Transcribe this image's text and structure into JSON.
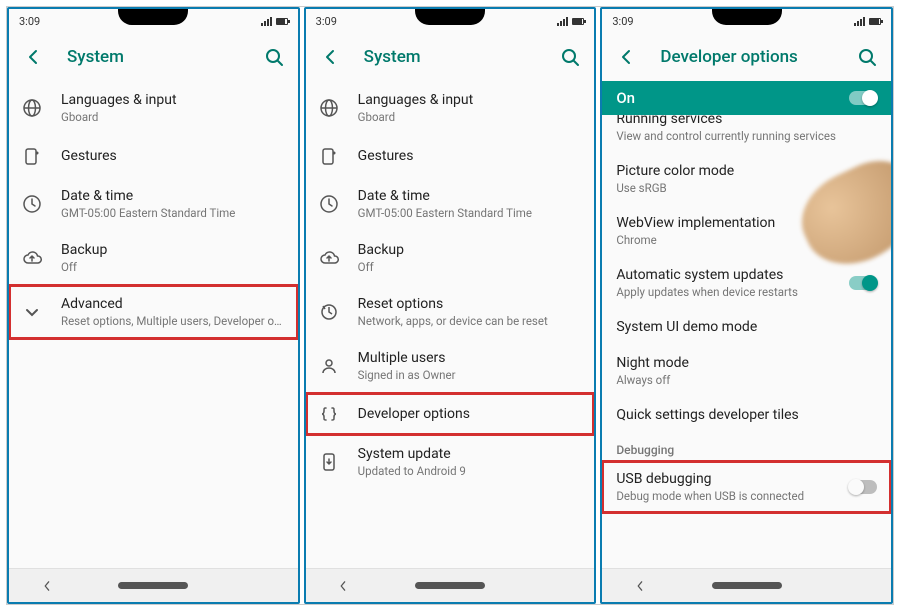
{
  "status": {
    "time": "3:09"
  },
  "screen1": {
    "title": "System",
    "items": [
      {
        "primary": "Languages & input",
        "secondary": "Gboard",
        "icon": "globe"
      },
      {
        "primary": "Gestures",
        "secondary": "",
        "icon": "gesture"
      },
      {
        "primary": "Date & time",
        "secondary": "GMT-05:00 Eastern Standard Time",
        "icon": "clock"
      },
      {
        "primary": "Backup",
        "secondary": "Off",
        "icon": "cloud-up"
      },
      {
        "primary": "Advanced",
        "secondary": "Reset options, Multiple users, Developer o…",
        "icon": "chevron-down",
        "highlight": true
      }
    ]
  },
  "screen2": {
    "title": "System",
    "items": [
      {
        "primary": "Languages & input",
        "secondary": "Gboard",
        "icon": "globe"
      },
      {
        "primary": "Gestures",
        "secondary": "",
        "icon": "gesture"
      },
      {
        "primary": "Date & time",
        "secondary": "GMT-05:00 Eastern Standard Time",
        "icon": "clock"
      },
      {
        "primary": "Backup",
        "secondary": "Off",
        "icon": "cloud-up"
      },
      {
        "primary": "Reset options",
        "secondary": "Network, apps, or device can be reset",
        "icon": "reset"
      },
      {
        "primary": "Multiple users",
        "secondary": "Signed in as Owner",
        "icon": "person"
      },
      {
        "primary": "Developer options",
        "secondary": "",
        "icon": "braces",
        "highlight": true
      },
      {
        "primary": "System update",
        "secondary": "Updated to Android 9",
        "icon": "phone-update"
      }
    ]
  },
  "screen3": {
    "title": "Developer options",
    "on_label": "On",
    "items": [
      {
        "primary": "Running services",
        "secondary": "View and control currently running services",
        "partial": true
      },
      {
        "primary": "Picture color mode",
        "secondary": "Use sRGB"
      },
      {
        "primary": "WebView implementation",
        "secondary": "Chrome"
      },
      {
        "primary": "Automatic system updates",
        "secondary": "Apply updates when device restarts",
        "toggle": "on"
      },
      {
        "primary": "System UI demo mode",
        "secondary": ""
      },
      {
        "primary": "Night mode",
        "secondary": "Always off"
      },
      {
        "primary": "Quick settings developer tiles",
        "secondary": ""
      }
    ],
    "section": "Debugging",
    "usb": {
      "primary": "USB debugging",
      "secondary": "Debug mode when USB is connected",
      "toggle": "off",
      "highlight": true
    }
  }
}
